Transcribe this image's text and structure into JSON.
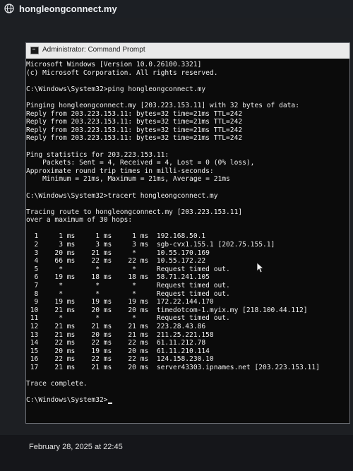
{
  "browser": {
    "url": "hongleongconnect.my"
  },
  "window": {
    "title": "Administrator: Command Prompt"
  },
  "console": {
    "lines": [
      "Microsoft Windows [Version 10.0.26100.3321]",
      "(c) Microsoft Corporation. All rights reserved.",
      "",
      "C:\\Windows\\System32>ping hongleongconnect.my",
      "",
      "Pinging hongleongconnect.my [203.223.153.11] with 32 bytes of data:",
      "Reply from 203.223.153.11: bytes=32 time=21ms TTL=242",
      "Reply from 203.223.153.11: bytes=32 time=21ms TTL=242",
      "Reply from 203.223.153.11: bytes=32 time=21ms TTL=242",
      "Reply from 203.223.153.11: bytes=32 time=21ms TTL=242",
      "",
      "Ping statistics for 203.223.153.11:",
      "    Packets: Sent = 4, Received = 4, Lost = 0 (0% loss),",
      "Approximate round trip times in milli-seconds:",
      "    Minimum = 21ms, Maximum = 21ms, Average = 21ms",
      "",
      "C:\\Windows\\System32>tracert hongleongconnect.my",
      "",
      "Tracing route to hongleongconnect.my [203.223.153.11]",
      "over a maximum of 30 hops:",
      "",
      "  1     1 ms     1 ms     1 ms  192.168.50.1",
      "  2     3 ms     3 ms     3 ms  sgb-cvx1.155.1 [202.75.155.1]",
      "  3    20 ms    21 ms     *     10.55.170.169",
      "  4    66 ms    22 ms    22 ms  10.55.172.22",
      "  5     *        *        *     Request timed out.",
      "  6    19 ms    18 ms    18 ms  58.71.241.105",
      "  7     *        *        *     Request timed out.",
      "  8     *        *        *     Request timed out.",
      "  9    19 ms    19 ms    19 ms  172.22.144.170",
      " 10    21 ms    20 ms    20 ms  timedotcom-1.myix.my [218.100.44.112]",
      " 11     *        *        *     Request timed out.",
      " 12    21 ms    21 ms    21 ms  223.28.43.86",
      " 13    21 ms    20 ms    21 ms  211.25.221.158",
      " 14    22 ms    22 ms    22 ms  61.11.212.78",
      " 15    20 ms    19 ms    20 ms  61.11.210.114",
      " 16    22 ms    22 ms    22 ms  124.158.230.10",
      " 17    21 ms    21 ms    20 ms  server43303.ipnames.net [203.223.153.11]",
      "",
      "Trace complete.",
      "",
      "C:\\Windows\\System32>"
    ]
  },
  "footer": {
    "date": "February 28, 2025 at 22:45"
  },
  "colors": {
    "console_bg": "#0b0b0b",
    "console_text": "#f1f1f1",
    "titlebar": "#eaeaea"
  }
}
